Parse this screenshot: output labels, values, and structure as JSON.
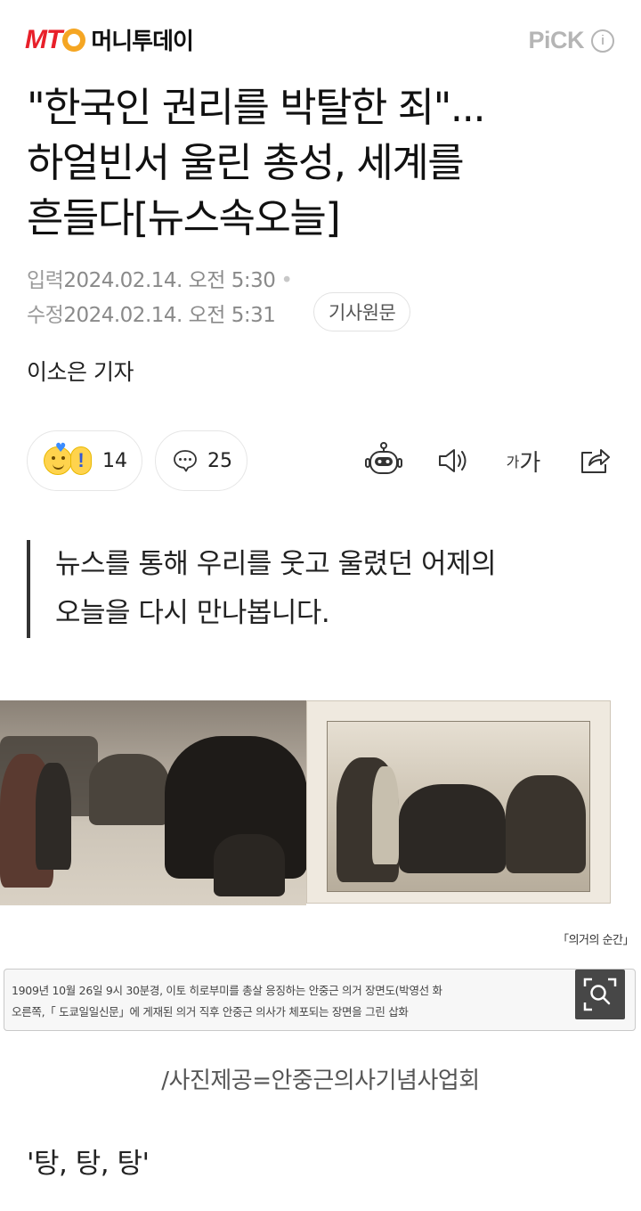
{
  "brand": {
    "logo_mark": "MT",
    "logo_name": "머니투데이",
    "pick_label": "PiCK",
    "info_symbol": "i"
  },
  "article": {
    "headline_lines": [
      "\"한국인 권리를 박탈한 죄\"...",
      "하얼빈서 울린 총성, 세계를",
      "흔들다[뉴스속오늘]"
    ],
    "published_label": "입력",
    "published": "2024.02.14. 오전 5:30",
    "modified_label": "수정",
    "modified": "2024.02.14. 오전 5:31",
    "original_button": "기사원문",
    "reporter": "이소은 기자"
  },
  "actions": {
    "reaction_count": "14",
    "comment_count": "25",
    "font_small": "가",
    "font_big": "가",
    "icons": [
      "reaction-emoji-icon",
      "comment-icon",
      "summary-bot-icon",
      "speaker-icon",
      "font-size-icon",
      "share-icon"
    ]
  },
  "quote": {
    "lines": [
      "뉴스를 통해 우리를 웃고 울렸던 어제의",
      "오늘을 다시 만나봅니다."
    ]
  },
  "photo": {
    "source_tag": "「의거의 순간」",
    "caption_lines": [
      "1909년 10월 26일 9시 30분경, 이토 히로부미를 총살 응징하는 안중근 의거 장면도(박영선 화",
      "오른쪽,「 도쿄일일신문」에 게재된 의거 직후 안중근 의사가 체포되는 장면을 그린 삽화"
    ],
    "credit": "/사진제공=안중근의사기념사업회"
  },
  "body": {
    "first_line": "'탕, 탕, 탕'"
  },
  "colors": {
    "brand_red": "#e8202a",
    "brand_orange": "#f5a623",
    "pick_gray": "#b5b5b5"
  }
}
